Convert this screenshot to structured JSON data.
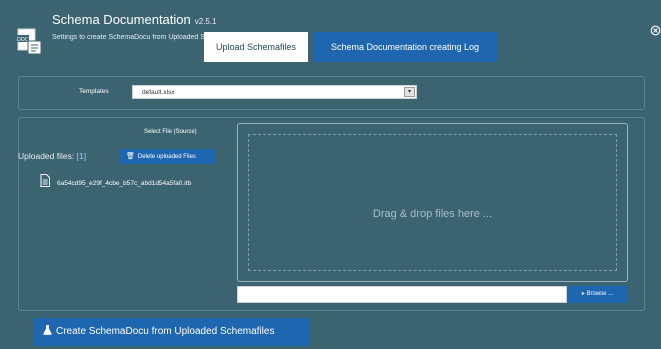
{
  "app": {
    "title": "Schema Documentation",
    "version": "v2.5.1",
    "subtitle": "Settings to create SchemaDocu from Uploaded Schemafiles",
    "icon": "document-icon",
    "close_icon": "⊗"
  },
  "tabs": [
    {
      "label": "Upload Schemafiles",
      "active": true
    },
    {
      "label": "Schema Documentation creating Log",
      "active": false
    }
  ],
  "templates": {
    "label": "Templates",
    "selected": "default.xlsx",
    "arrow": "▾"
  },
  "files": {
    "select_label": "Select File (Source)",
    "uploaded_label": "Uploaded files:",
    "uploaded_count": "[1]",
    "delete_button": "Delete uploaded Files",
    "delete_icon": "🗑",
    "items": [
      {
        "name": "6a54cd95_e29f_4cbe_b57c_abd1d54a5fa0.itb",
        "icon": "file-icon"
      }
    ]
  },
  "dropzone": {
    "hint": "Drag & drop files here ..."
  },
  "file_input": {
    "value": "",
    "browse_button": "Browse ..."
  },
  "create_button": {
    "label": "Create SchemaDocu from Uploaded Schemafiles",
    "icon": "flask-icon"
  },
  "colors": {
    "background": "#3b6470",
    "accent": "#1f66b0",
    "tab_active": "#ffffff"
  }
}
